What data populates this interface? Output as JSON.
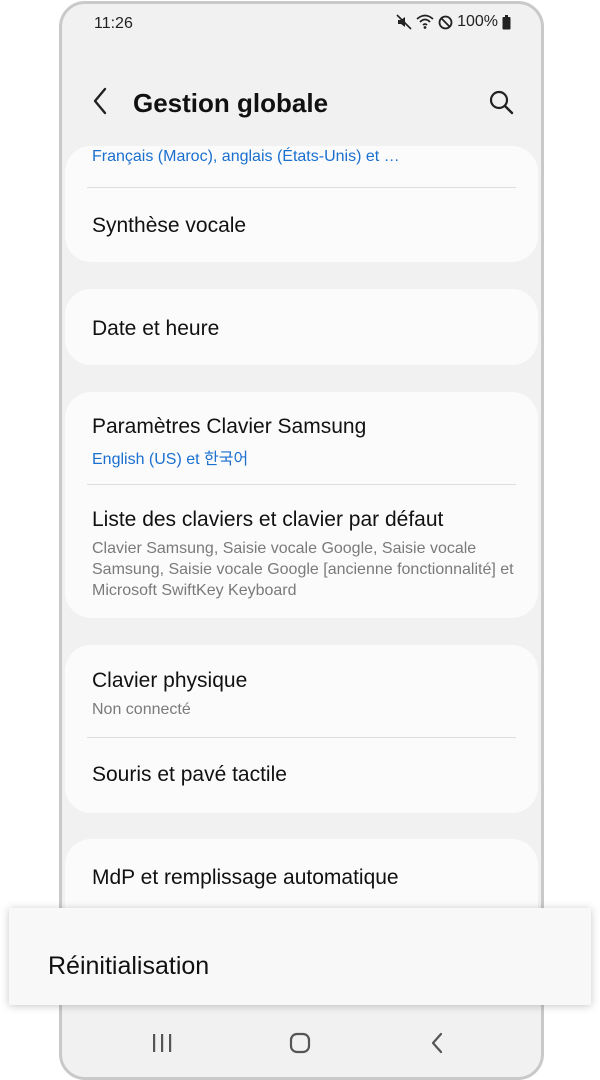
{
  "status_bar": {
    "time": "11:26",
    "battery_percent": "100%",
    "icons": [
      "mute-icon",
      "wifi-icon",
      "dnd-icon",
      "battery-icon"
    ]
  },
  "app_bar": {
    "title": "Gestion globale",
    "back_icon": "chevron-left-icon",
    "search_icon": "search-icon"
  },
  "sections": {
    "language": {
      "subtitle": "Français (Maroc), anglais (États-Unis) et …",
      "tts_title": "Synthèse vocale"
    },
    "date": {
      "title": "Date et heure"
    },
    "keyboard": {
      "samsung_title": "Paramètres Clavier Samsung",
      "samsung_sub": "English (US) et 한국어",
      "list_title": "Liste des claviers et clavier par défaut",
      "list_desc": "Clavier Samsung, Saisie vocale Google, Saisie vocale Samsung, Saisie vocale Google [ancienne fonctionnalité] et Microsoft SwiftKey Keyboard"
    },
    "physical": {
      "title": "Clavier physique",
      "sub": "Non connecté",
      "mouse_title": "Souris et pavé tactile"
    },
    "password": {
      "title": "MdP et remplissage automatique"
    }
  },
  "highlight": {
    "label": "Réinitialisation"
  },
  "colors": {
    "background": "#f1f1f1",
    "card": "#fbfbfb",
    "accent_blue": "#1a6fcf",
    "secondary_text": "#7a7a7a"
  },
  "nav_bar": {
    "recents_icon": "recents-icon",
    "home_icon": "home-icon",
    "back_icon": "back-icon"
  }
}
